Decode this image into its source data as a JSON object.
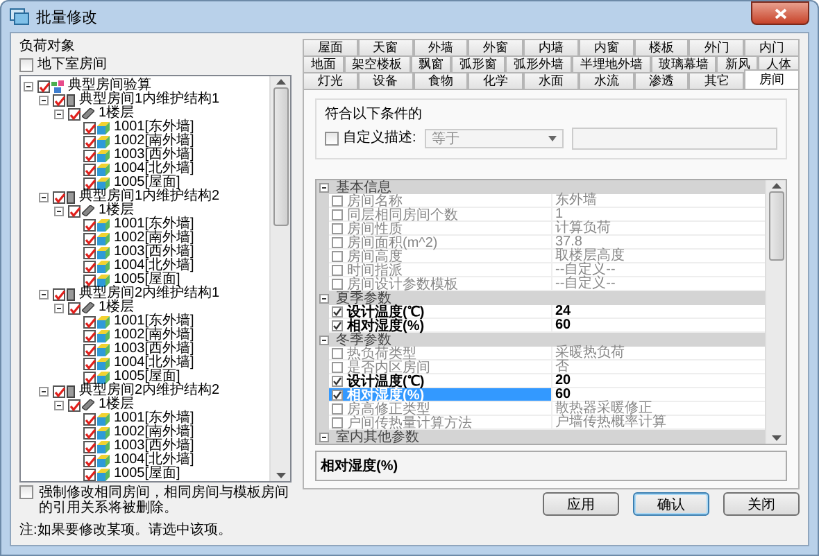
{
  "window": {
    "title": "批量修改"
  },
  "load_objects": {
    "title": "负荷对象",
    "basement": {
      "label": "地下室房间",
      "checked": false
    },
    "tree": [
      {
        "label": "典型房间验算",
        "kind": "project",
        "checked": true,
        "expanded": true,
        "children": [
          {
            "label": "典型房间1内维护结构1",
            "kind": "group",
            "checked": true,
            "expanded": true,
            "children": [
              {
                "label": "1楼层",
                "kind": "floor",
                "checked": true,
                "expanded": true,
                "children": [
                  {
                    "label": "1001[东外墙]",
                    "kind": "room",
                    "checked": true
                  },
                  {
                    "label": "1002[南外墙]",
                    "kind": "room",
                    "checked": true
                  },
                  {
                    "label": "1003[西外墙]",
                    "kind": "room",
                    "checked": true
                  },
                  {
                    "label": "1004[北外墙]",
                    "kind": "room",
                    "checked": true
                  },
                  {
                    "label": "1005[屋面]",
                    "kind": "room",
                    "checked": true
                  }
                ]
              }
            ]
          },
          {
            "label": "典型房间1内维护结构2",
            "kind": "group",
            "checked": true,
            "expanded": true,
            "children": [
              {
                "label": "1楼层",
                "kind": "floor",
                "checked": true,
                "expanded": true,
                "children": [
                  {
                    "label": "1001[东外墙]",
                    "kind": "room",
                    "checked": true
                  },
                  {
                    "label": "1002[南外墙]",
                    "kind": "room",
                    "checked": true
                  },
                  {
                    "label": "1003[西外墙]",
                    "kind": "room",
                    "checked": true
                  },
                  {
                    "label": "1004[北外墙]",
                    "kind": "room",
                    "checked": true
                  },
                  {
                    "label": "1005[屋面]",
                    "kind": "room",
                    "checked": true
                  }
                ]
              }
            ]
          },
          {
            "label": "典型房间2内维护结构1",
            "kind": "group",
            "checked": true,
            "expanded": true,
            "children": [
              {
                "label": "1楼层",
                "kind": "floor",
                "checked": true,
                "expanded": true,
                "children": [
                  {
                    "label": "1001[东外墙]",
                    "kind": "room",
                    "checked": true
                  },
                  {
                    "label": "1002[南外墙]",
                    "kind": "room",
                    "checked": true
                  },
                  {
                    "label": "1003[西外墙]",
                    "kind": "room",
                    "checked": true
                  },
                  {
                    "label": "1004[北外墙]",
                    "kind": "room",
                    "checked": true
                  },
                  {
                    "label": "1005[屋面]",
                    "kind": "room",
                    "checked": true
                  }
                ]
              }
            ]
          },
          {
            "label": "典型房间2内维护结构2",
            "kind": "group",
            "checked": true,
            "expanded": true,
            "children": [
              {
                "label": "1楼层",
                "kind": "floor",
                "checked": true,
                "expanded": true,
                "children": [
                  {
                    "label": "1001[东外墙]",
                    "kind": "room",
                    "checked": true
                  },
                  {
                    "label": "1002[南外墙]",
                    "kind": "room",
                    "checked": true
                  },
                  {
                    "label": "1003[西外墙]",
                    "kind": "room",
                    "checked": true
                  },
                  {
                    "label": "1004[北外墙]",
                    "kind": "room",
                    "checked": true
                  },
                  {
                    "label": "1005[屋面]",
                    "kind": "room",
                    "checked": true
                  }
                ]
              }
            ]
          }
        ]
      }
    ],
    "force": {
      "label": "强制修改相同房间，相同房间与模板房间的引用关系将被删除。",
      "checked": false
    }
  },
  "tab_rows": [
    [
      {
        "label": "屋面",
        "selected": false
      },
      {
        "label": "天窗",
        "selected": false
      },
      {
        "label": "外墙",
        "selected": false
      },
      {
        "label": "外窗",
        "selected": false
      },
      {
        "label": "内墙",
        "selected": false
      },
      {
        "label": "内窗",
        "selected": false
      },
      {
        "label": "楼板",
        "selected": false
      },
      {
        "label": "外门",
        "selected": false
      },
      {
        "label": "内门",
        "selected": false
      }
    ],
    [
      {
        "label": "地面",
        "selected": false
      },
      {
        "label": "架空楼板",
        "selected": false
      },
      {
        "label": "飘窗",
        "selected": false
      },
      {
        "label": "弧形窗",
        "selected": false
      },
      {
        "label": "弧形外墙",
        "selected": false
      },
      {
        "label": "半埋地外墙",
        "selected": false
      },
      {
        "label": "玻璃幕墙",
        "selected": false
      },
      {
        "label": "新风",
        "selected": false
      },
      {
        "label": "人体",
        "selected": false
      }
    ],
    [
      {
        "label": "灯光",
        "selected": false
      },
      {
        "label": "设备",
        "selected": false
      },
      {
        "label": "食物",
        "selected": false
      },
      {
        "label": "化学",
        "selected": false
      },
      {
        "label": "水面",
        "selected": false
      },
      {
        "label": "水流",
        "selected": false
      },
      {
        "label": "渗透",
        "selected": false
      },
      {
        "label": "其它",
        "selected": false
      },
      {
        "label": "房间",
        "selected": true
      }
    ]
  ],
  "filter": {
    "title": "符合以下条件的",
    "custom": {
      "label": "自定义描述:",
      "checked": false
    },
    "operator": "等于"
  },
  "properties": {
    "categories": [
      {
        "name": "基本信息",
        "expanded": true,
        "rows": [
          {
            "name": "房间名称",
            "value": "东外墙",
            "checked": false,
            "selected": false
          },
          {
            "name": "同层相同房间个数",
            "value": "1",
            "checked": false,
            "selected": false
          },
          {
            "name": "房间性质",
            "value": "计算负荷",
            "checked": false,
            "selected": false
          },
          {
            "name": "房间面积(m^2)",
            "value": "37.8",
            "checked": false,
            "selected": false
          },
          {
            "name": "房间高度",
            "value": "取楼层高度",
            "checked": false,
            "selected": false
          },
          {
            "name": "时间指派",
            "value": "--自定义--",
            "checked": false,
            "selected": false
          },
          {
            "name": "房间设计参数模板",
            "value": "--自定义--",
            "checked": false,
            "selected": false
          }
        ]
      },
      {
        "name": "夏季参数",
        "expanded": true,
        "rows": [
          {
            "name": "设计温度(℃)",
            "value": "24",
            "checked": true,
            "selected": false
          },
          {
            "name": "相对湿度(%)",
            "value": "60",
            "checked": true,
            "selected": false
          }
        ]
      },
      {
        "name": "冬季参数",
        "expanded": true,
        "rows": [
          {
            "name": "热负荷类型",
            "value": "采暖热负荷",
            "checked": false,
            "selected": false
          },
          {
            "name": "是否内区房间",
            "value": "否",
            "checked": false,
            "selected": false
          },
          {
            "name": "设计温度(℃)",
            "value": "20",
            "checked": true,
            "selected": false
          },
          {
            "name": "相对湿度(%)",
            "value": "60",
            "checked": true,
            "selected": true
          },
          {
            "name": "房高修正类型",
            "value": "散热器采暖修正",
            "checked": false,
            "selected": false
          },
          {
            "name": "户间传热量计算方法",
            "value": "户墙传热概率计算",
            "checked": false,
            "selected": false
          }
        ]
      },
      {
        "name": "室内其他参数",
        "expanded": true
      }
    ],
    "description": "相对湿度(%)"
  },
  "buttons": [
    {
      "label": "应用",
      "default": false
    },
    {
      "label": "确认",
      "default": true
    },
    {
      "label": "关闭",
      "default": false
    }
  ],
  "note": "注:如果要修改某项。请选中该项。"
}
